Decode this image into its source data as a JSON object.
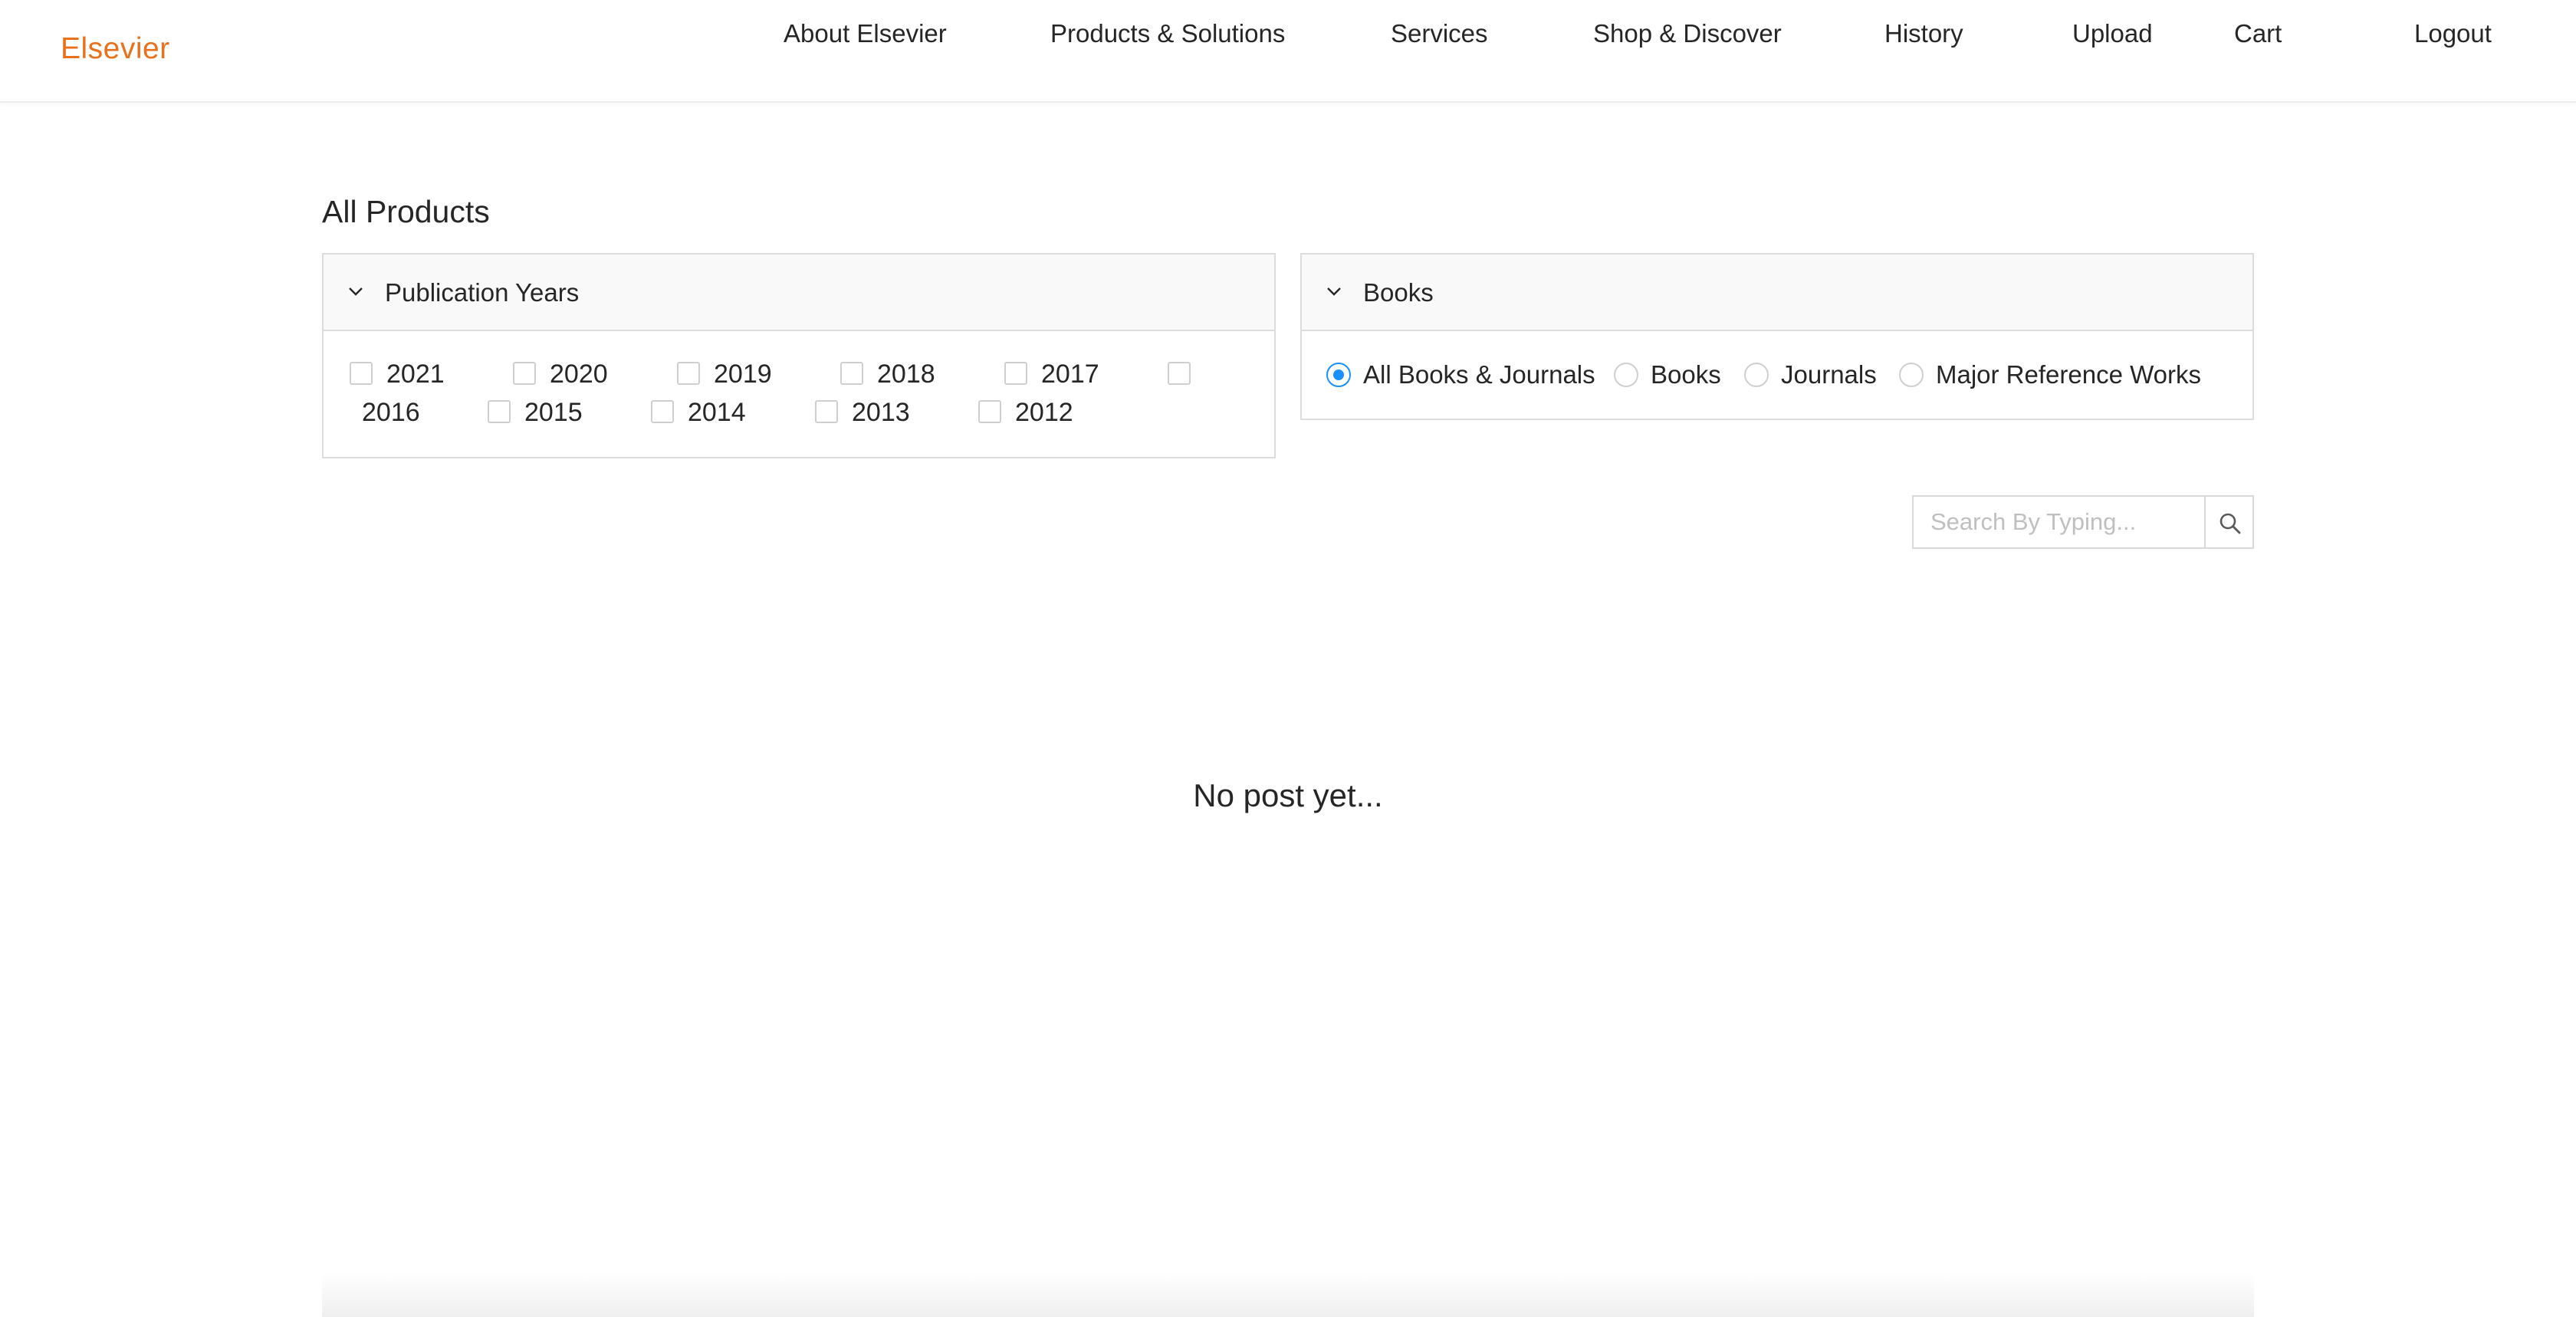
{
  "brand": {
    "logo": "Elsevier",
    "accent": "#e9711c"
  },
  "nav": [
    {
      "label": "About Elsevier"
    },
    {
      "label": "Products & Solutions"
    },
    {
      "label": "Services"
    },
    {
      "label": "Shop & Discover"
    },
    {
      "label": "History"
    },
    {
      "label": "Upload"
    },
    {
      "label": "Cart"
    },
    {
      "label": "Logout"
    }
  ],
  "page": {
    "title": "All Products"
  },
  "filters": {
    "years": {
      "title": "Publication Years",
      "options": [
        "2021",
        "2020",
        "2019",
        "2018",
        "2017",
        "2016",
        "2015",
        "2014",
        "2013",
        "2012"
      ]
    },
    "types": {
      "title": "Books",
      "options": [
        "All Books & Journals",
        "Books",
        "Journals",
        "Major Reference Works"
      ],
      "selected": "All Books & Journals"
    }
  },
  "search": {
    "placeholder": "Search By Typing...",
    "value": ""
  },
  "empty_state": {
    "message": "No post yet..."
  },
  "colors": {
    "radio_selected": "#1890ff",
    "panel_head_bg": "#f9f9f9"
  }
}
